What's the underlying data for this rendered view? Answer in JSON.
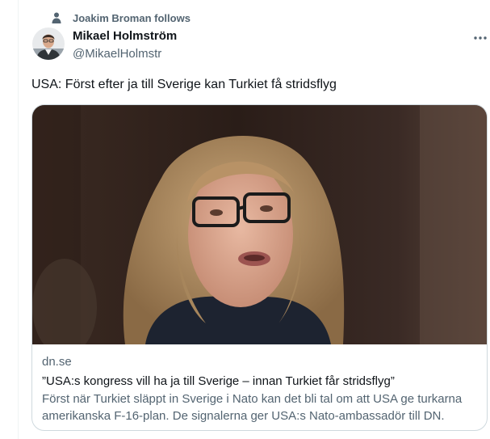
{
  "social_context": {
    "icon": "person-icon",
    "text": "Joakim Broman follows"
  },
  "author": {
    "name": "Mikael Holmström",
    "handle": "@MikaelHolmstr",
    "avatar_icon": "avatar-photo"
  },
  "more_icon": "more-icon",
  "tweet": {
    "text": "USA: Först efter ja till Sverige kan Turkiet få stridsflyg"
  },
  "card": {
    "image": "news-photo",
    "domain": "dn.se",
    "title": "”USA:s kongress vill ha ja till Sverige – innan Turkiet får stridsflyg”",
    "description": "Först när Turkiet släppt in Sverige i Nato kan det bli tal om att USA ge turkarna amerikanska F-16-plan. De signalerna ger USA:s Nato-ambassadör till DN."
  },
  "colors": {
    "text_primary": "#0f1419",
    "text_secondary": "#536471",
    "border": "#cfd9de"
  }
}
